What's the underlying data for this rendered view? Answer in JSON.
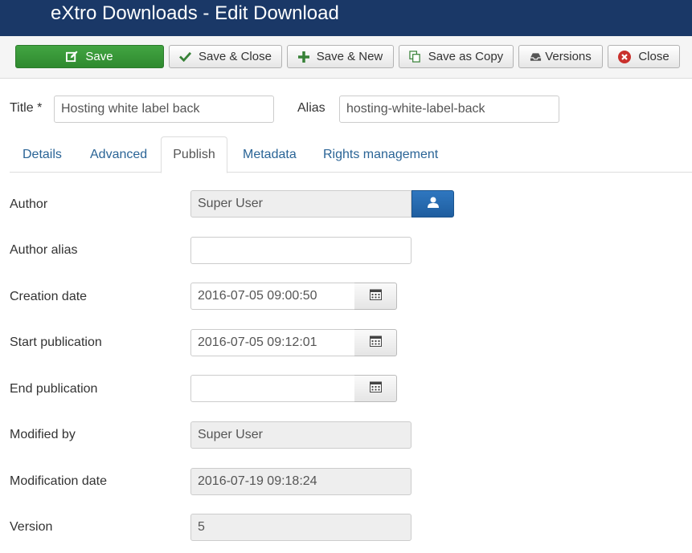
{
  "header": {
    "title": "eXtro Downloads - Edit Download"
  },
  "toolbar": {
    "save": "Save",
    "save_close": "Save & Close",
    "save_new": "Save & New",
    "save_copy": "Save as Copy",
    "versions": "Versions",
    "close": "Close"
  },
  "title_field": {
    "label": "Title *",
    "value": "Hosting white label back"
  },
  "alias_field": {
    "label": "Alias",
    "value": "hosting-white-label-back"
  },
  "tabs": [
    "Details",
    "Advanced",
    "Publish",
    "Metadata",
    "Rights management"
  ],
  "active_tab": "Publish",
  "publish": {
    "author": {
      "label": "Author",
      "value": "Super User"
    },
    "author_alias": {
      "label": "Author alias",
      "value": ""
    },
    "creation_date": {
      "label": "Creation date",
      "value": "2016-07-05 09:00:50"
    },
    "start_publication": {
      "label": "Start publication",
      "value": "2016-07-05 09:12:01"
    },
    "end_publication": {
      "label": "End publication",
      "value": ""
    },
    "modified_by": {
      "label": "Modified by",
      "value": "Super User"
    },
    "modification_date": {
      "label": "Modification date",
      "value": "2016-07-19 09:18:24"
    },
    "version": {
      "label": "Version",
      "value": "5"
    }
  },
  "icons": {
    "save": "edit-icon",
    "save_close": "check-icon",
    "save_new": "plus-icon",
    "save_copy": "copy-icon",
    "versions": "archive-icon",
    "close": "close-circle-icon",
    "author_select": "user-icon",
    "calendar": "calendar-icon"
  },
  "colors": {
    "header_bg": "#1a3867",
    "save_green": "#3a9a3a",
    "link_blue": "#2a6496",
    "user_btn": "#2a6fb5",
    "close_red": "#c9302c"
  }
}
